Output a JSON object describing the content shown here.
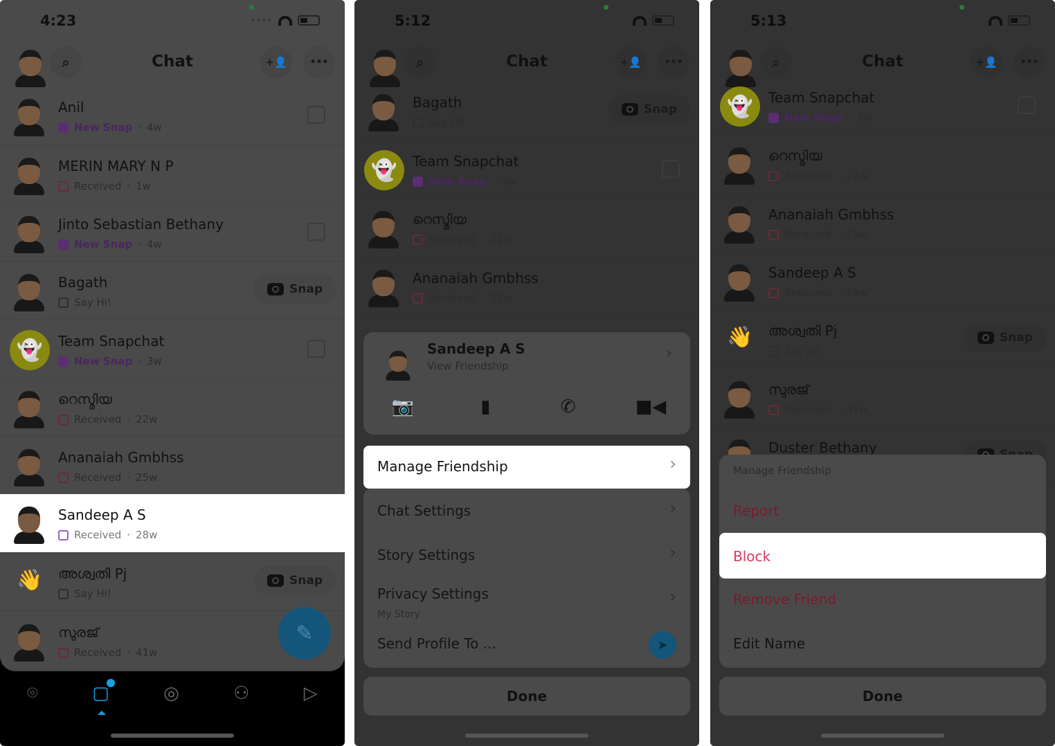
{
  "colors": {
    "accent": "#1aa0e0",
    "new_snap": "#9b5cd0",
    "received": "#e0365a",
    "block_red": "#e0365a",
    "highlight": "#ffffff"
  },
  "panels": [
    {
      "status_bar": {
        "time": "4:23"
      },
      "header": {
        "title": "Chat",
        "search_icon": "search-icon",
        "add_friend_icon": "add-friend-icon",
        "more_icon": "more-icon"
      },
      "rows": [
        {
          "name": "Anil",
          "status": "New Snap",
          "type": "new",
          "time": "4w",
          "action": "chat",
          "avatar": "bitmoji"
        },
        {
          "name": "MERIN MARY  N P",
          "status": "Received",
          "type": "received",
          "time": "1w",
          "action": "",
          "avatar": "bitmoji"
        },
        {
          "name": "Jinto Sebastian Bethany",
          "status": "New Snap",
          "type": "new",
          "time": "4w",
          "action": "chat",
          "avatar": "bitmoji"
        },
        {
          "name": "Bagath",
          "status": "Say Hi!",
          "type": "sayhi",
          "time": "",
          "action": "snap",
          "avatar": "bitmoji"
        },
        {
          "name": "Team Snapchat",
          "status": "New Snap",
          "type": "new",
          "time": "3w",
          "action": "chat",
          "avatar": "ghost"
        },
        {
          "name": "റെസ്മിയ",
          "status": "Received",
          "type": "received",
          "time": "22w",
          "action": "",
          "avatar": "bitmoji"
        },
        {
          "name": "Ananaiah Gmbhss",
          "status": "Received",
          "type": "received",
          "time": "25w",
          "action": "",
          "avatar": "bitmoji"
        },
        {
          "name": "Sandeep A S",
          "status": "Received",
          "type": "received",
          "time": "28w",
          "action": "",
          "avatar": "bitmoji",
          "highlighted": true
        },
        {
          "name": "അശ്വതി Pj",
          "status": "Say Hi!",
          "type": "sayhi",
          "time": "",
          "action": "snap",
          "avatar": "wave"
        },
        {
          "name": "സുരജ്",
          "status": "Received",
          "type": "received",
          "time": "41w",
          "action": "",
          "avatar": "bitmoji"
        }
      ],
      "snap_label": "Snap",
      "nav": [
        {
          "icon": "map-icon"
        },
        {
          "icon": "chat-icon",
          "active": true,
          "badge": true
        },
        {
          "icon": "camera-icon"
        },
        {
          "icon": "friends-icon"
        },
        {
          "icon": "stories-icon"
        }
      ]
    },
    {
      "status_bar": {
        "time": "5:12"
      },
      "header": {
        "title": "Chat"
      },
      "rows": [
        {
          "name": "Bagath",
          "status": "Say Hi!",
          "type": "sayhi",
          "time": "",
          "action": "snap",
          "avatar": "bitmoji"
        },
        {
          "name": "Team Snapchat",
          "status": "New Snap",
          "type": "new",
          "time": "3w",
          "action": "chat",
          "avatar": "ghost"
        },
        {
          "name": "റെസ്മിയ",
          "status": "Received",
          "type": "received",
          "time": "22w",
          "action": "",
          "avatar": "bitmoji"
        },
        {
          "name": "Ananaiah Gmbhss",
          "status": "Received",
          "type": "received",
          "time": "25w",
          "action": "",
          "avatar": "bitmoji"
        }
      ],
      "snap_label": "Snap",
      "friend_card": {
        "name": "Sandeep A S",
        "subtitle": "View Friendship",
        "actions": [
          "camera-icon",
          "chat-icon",
          "phone-icon",
          "video-icon"
        ]
      },
      "menu": [
        {
          "label": "Manage Friendship",
          "highlighted": true
        },
        {
          "label": "Chat Settings"
        },
        {
          "label": "Story Settings"
        },
        {
          "label": "Privacy Settings",
          "sublabel": "My Story"
        },
        {
          "label": "Send Profile To ..."
        }
      ],
      "done_label": "Done"
    },
    {
      "status_bar": {
        "time": "5:13"
      },
      "header": {
        "title": "Chat"
      },
      "rows": [
        {
          "name": "Team Snapchat",
          "status": "New Snap",
          "type": "new",
          "time": "3w",
          "action": "chat",
          "avatar": "ghost"
        },
        {
          "name": "റെസ്മിയ",
          "status": "Received",
          "type": "received",
          "time": "22w",
          "action": "",
          "avatar": "bitmoji"
        },
        {
          "name": "Ananaiah Gmbhss",
          "status": "Received",
          "type": "received",
          "time": "25w",
          "action": "",
          "avatar": "bitmoji"
        },
        {
          "name": "Sandeep A S",
          "status": "Received",
          "type": "received",
          "time": "28w",
          "action": "",
          "avatar": "bitmoji"
        },
        {
          "name": "അശ്വതി Pj",
          "status": "Say Hi!",
          "type": "sayhi",
          "time": "",
          "action": "snap",
          "avatar": "wave"
        },
        {
          "name": "സുരജ്",
          "status": "Received",
          "type": "received",
          "time": "41w",
          "action": "",
          "avatar": "bitmoji"
        },
        {
          "name": "Duster Bethany",
          "status": "",
          "type": "",
          "time": "",
          "action": "snap",
          "avatar": "bitmoji"
        }
      ],
      "snap_label": "Snap",
      "menu_title": "Manage Friendship",
      "menu": [
        {
          "label": "Report",
          "style": "red"
        },
        {
          "label": "Block",
          "style": "red-bright",
          "highlighted": true
        },
        {
          "label": "Remove Friend",
          "style": "red"
        },
        {
          "label": "Edit Name"
        }
      ],
      "done_label": "Done"
    }
  ]
}
